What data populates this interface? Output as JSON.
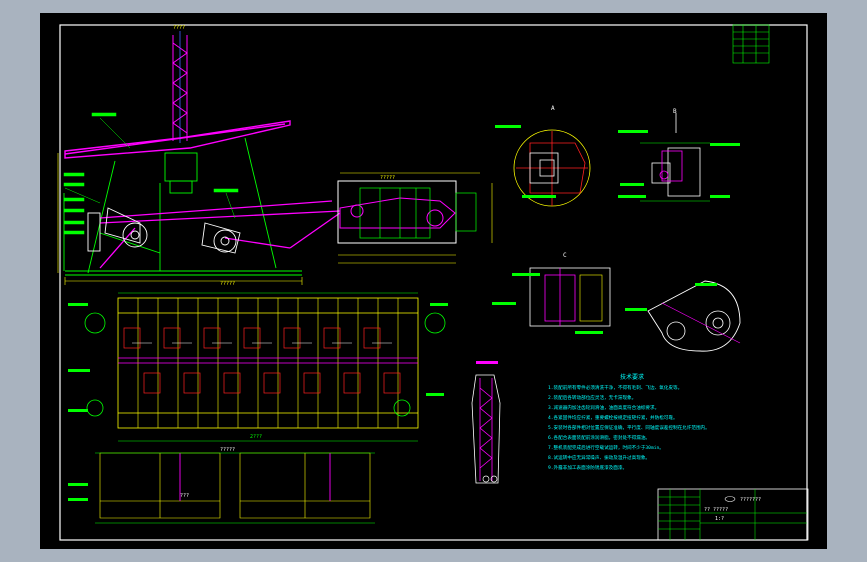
{
  "colors": {
    "background": "#000000",
    "frame": "#ffffff",
    "lines_green": "#00ff00",
    "lines_yellow": "#ffff00",
    "lines_magenta": "#ff00ff",
    "lines_red": "#ff2020",
    "lines_white": "#ffffff",
    "notes_cyan": "#00ffff",
    "app_chrome": "#a9b3bf"
  },
  "views": {
    "section_a": "A",
    "section_b": "B",
    "section_c": "C"
  },
  "labels": {
    "plan_title": "?????",
    "tower_label": "????",
    "gearbox_label": "?????",
    "column_label": "?????",
    "bay_label": "???",
    "width_mark": "2???"
  },
  "notes": {
    "heading": "技术要求",
    "lines": [
      "1.装配前所有零件必须清洗干净，不得有毛刺、飞边、氧化皮等。",
      "2.装配后各转动部位应灵活，无卡滞现象。",
      "3.减速器内加注齿轮润滑油，油面高度符合油标要求。",
      "4.各紧固件均应拧紧，重要螺栓按规定扭矩拧紧，并防松可靠。",
      "5.安装时各部件相对位置应保证准确，平行度、同轴度误差控制在允许范围内。",
      "6.各配合表面装配前涂润滑脂，密封处不得漏油。",
      "7.整机装配完成后进行空载试运转，时间不少于30min。",
      "8.试运转中应无异常噪声、振动及温升过高现象。",
      "9.外露非加工表面涂防锈底漆及面漆。"
    ]
  },
  "title_block": {
    "drawing_title": "?? ?????",
    "company": "???????",
    "scale": "1:?"
  }
}
